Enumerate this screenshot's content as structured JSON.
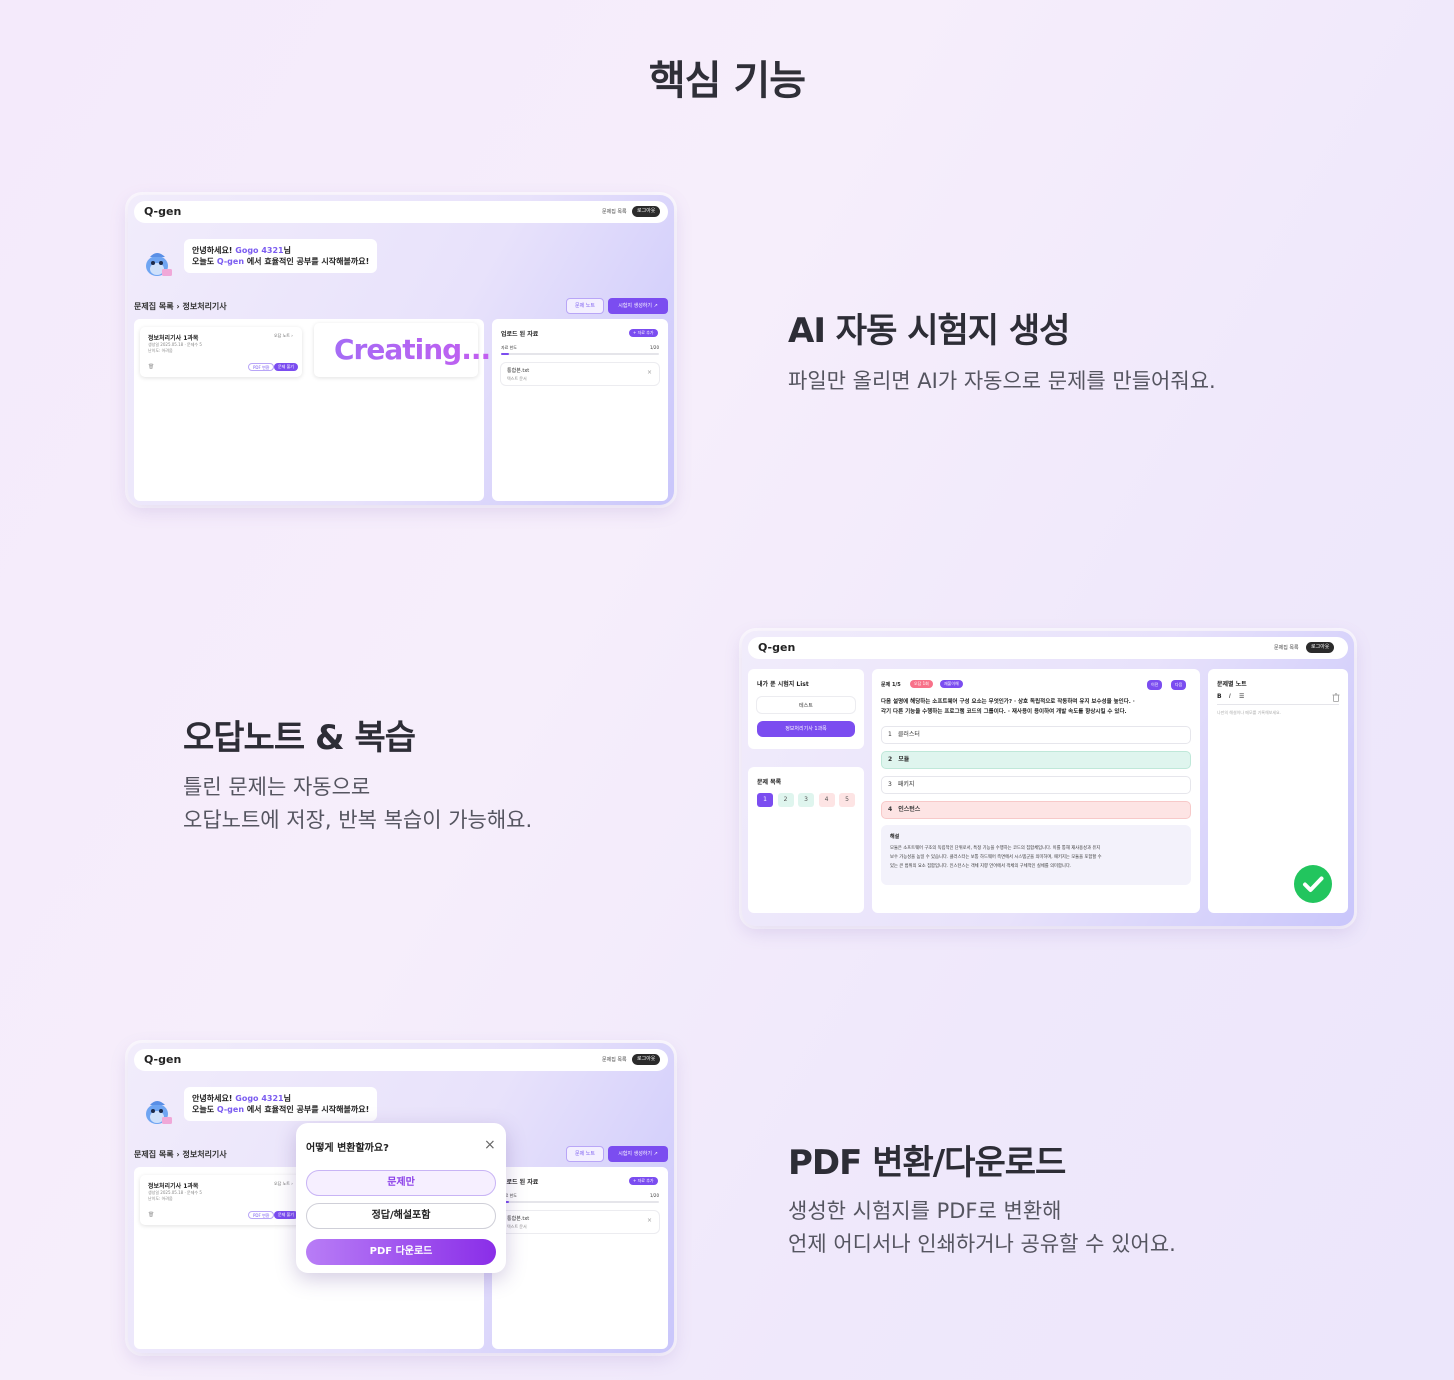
{
  "page": {
    "title": "핵심 기능"
  },
  "features": [
    {
      "title": "AI 자동 시험지 생성",
      "desc_line1": "파일만 올리면 AI가 자동으로 문제를 만들어줘요.",
      "desc_line2": ""
    },
    {
      "title": "오답노트 & 복습",
      "desc_line1": "틀린 문제는 자동으로",
      "desc_line2": "오답노트에 저장, 반복 복습이 가능해요."
    },
    {
      "title": "PDF 변환/다운로드",
      "desc_line1": "생성한 시험지를 PDF로 변환해",
      "desc_line2": "언제 어디서나 인쇄하거나 공유할 수 있어요."
    }
  ],
  "app": {
    "logo": "Q-gen",
    "nav_list": "문제집 목록",
    "logout": "로그아웃",
    "greeting_prefix": "안녕하세요!",
    "username": "Gogo 4321",
    "greeting_suffix": "님",
    "greeting_line2_prefix": "오늘도",
    "greeting_line2_brand": "Q-gen",
    "greeting_line2_suffix": "에서 효율적인 공부를 시작해볼까요!",
    "breadcrumb_root": "문제집 목록",
    "breadcrumb_sep": "›",
    "breadcrumb_current": "정보처리기사",
    "btn_note": "문제 노트",
    "btn_generate": "시험지 생성하기 ↗",
    "card_title": "정보처리기사 1과목",
    "card_meta1": "생성일 2025.05.18 · 문제수 5",
    "card_meta2": "난이도: 어려움",
    "card_link": "오답 노트 ›",
    "card_pdf": "PDF 변환",
    "card_solve": "문제 풀기",
    "card_trash": "🗑",
    "creating": "Creating...",
    "uploaded_title": "업로드 된 자료",
    "add_file": "+ 자료 추가",
    "usage_label": "자료 한도",
    "usage_count": "1/20",
    "usage_fraction": 0.05,
    "file_name": "통합본.txt",
    "file_type": "텍스트 문서",
    "file_close": "×"
  },
  "quiz": {
    "solved_title": "내가 푼 시험지 List",
    "test_item": "테스트",
    "active_item": "정보처리기사 1과목",
    "list_title": "문제 목록",
    "numbers": [
      "1",
      "2",
      "3",
      "4",
      "5"
    ],
    "number_states": [
      "current",
      "correct",
      "correct",
      "wrong",
      "wrong"
    ],
    "q_label": "문제 1/5",
    "tag_wrong": "오답 1회",
    "tag_review": "재풀이해",
    "btn_prev": "이전",
    "btn_next": "다음",
    "question_line1": "다음 설명에 해당하는 소프트웨어 구성 요소는 무엇인가? · 상호 독립적으로 작동하며 유지 보수성을 높인다. ·",
    "question_line2": "각기 다른 기능을 수행하는 프로그램 코드의 그룹이다. · 재사용이 용이하여 개발 속도를 향상시킬 수 있다.",
    "options": [
      {
        "num": "1",
        "text": "클러스터",
        "state": "none"
      },
      {
        "num": "2",
        "text": "모듈",
        "state": "correct"
      },
      {
        "num": "3",
        "text": "패키지",
        "state": "none"
      },
      {
        "num": "4",
        "text": "인스턴스",
        "state": "wrong"
      }
    ],
    "explain_title": "해설",
    "explain_line1": "모듈은 소프트웨어 구조의 독립적인 단위로서, 특정 기능을 수행하는 코드의 집합체입니다. 이를 통해 재사용성과 유지",
    "explain_line2": "보수 가능성을 높일 수 있습니다. 클러스터는 보통 하드웨어 측면에서 시스템군을 의미하며, 패키지는 모듈을 포함할 수",
    "explain_line3": "있는 큰 범위의 요소 집합입니다. 인스턴스는 객체 지향 언어에서 객체의 구체적인 실체를 의미합니다.",
    "note_title": "문제별 노트",
    "tool_bold": "B",
    "tool_italic": "I",
    "tool_list": "☰",
    "note_placeholder": "나만의 해설이나 메모를 기록해보세요."
  },
  "pdf_modal": {
    "title": "어떻게 변환할까요?",
    "close": "×",
    "opt1": "문제만",
    "opt2": "정답/해설포함",
    "download": "PDF 다운로드"
  },
  "colors": {
    "accent": "#7b4df0",
    "correct_bg": "#dff5ee",
    "wrong_bg": "#fde4e4",
    "check_green": "#22c55e"
  }
}
